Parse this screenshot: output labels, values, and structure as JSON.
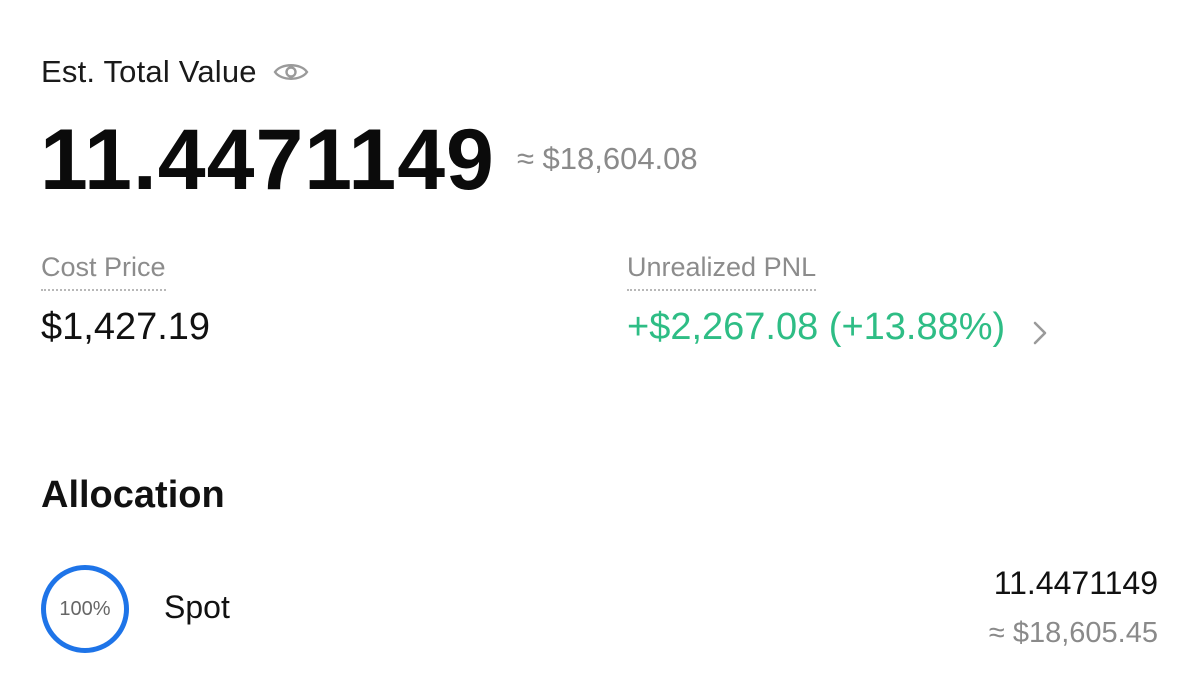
{
  "header": {
    "label": "Est. Total Value",
    "visibility_icon": "eye-icon"
  },
  "total": {
    "value": "11.4471149",
    "approx_usd": "≈ $18,604.08"
  },
  "metrics": {
    "cost_price": {
      "label": "Cost Price",
      "value": "$1,427.19"
    },
    "unrealized_pnl": {
      "label": "Unrealized PNL",
      "value": "+$2,267.08 (+13.88%)",
      "icon": "chevron-right-icon"
    }
  },
  "allocation": {
    "title": "Allocation",
    "items": [
      {
        "percent": "100%",
        "name": "Spot",
        "amount": "11.4471149",
        "approx_usd": "≈ $18,605.45"
      }
    ]
  },
  "colors": {
    "positive": "#2ebd85",
    "ring": "#1e74e8",
    "muted": "#8a8a8a"
  }
}
